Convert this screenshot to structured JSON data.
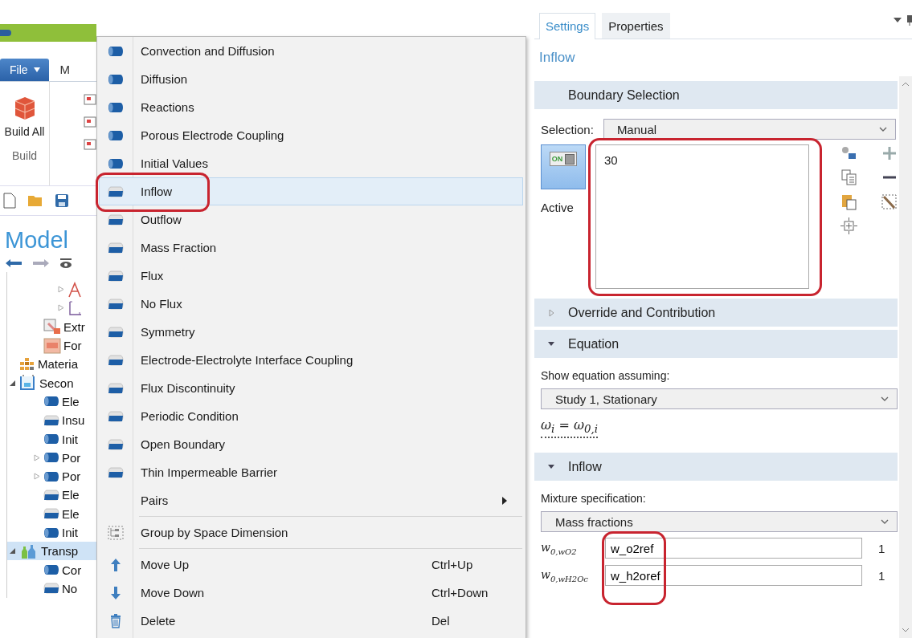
{
  "left": {
    "file_menu": "File",
    "next_tab": "M",
    "build_button": "Build All",
    "build_group": "Build",
    "browser_title": "Model",
    "tree": [
      {
        "children": [
          {
            "children": [
              {
                "kind": "sketch",
                "expanded": false,
                "selected": false
              },
              {
                "kind": "axes",
                "expanded": false,
                "selected": false
              }
            ]
          },
          {
            "kind": "operator",
            "label": "Extr",
            "selected": false
          },
          {
            "kind": "union",
            "label": "For",
            "selected": false
          }
        ]
      },
      {
        "kind": "materials",
        "label": "Materia",
        "selected": false
      },
      {
        "kind": "physics",
        "label": "Secon",
        "expanded": true,
        "selected": false,
        "children": [
          {
            "kind": "domain",
            "label": "Ele",
            "selected": false
          },
          {
            "kind": "boundary",
            "label": "Insu",
            "selected": false
          },
          {
            "kind": "domain",
            "label": "Init",
            "selected": false
          },
          {
            "kind": "domain",
            "label": "Por",
            "expanded": false,
            "selected": false
          },
          {
            "kind": "domain",
            "label": "Por",
            "expanded": false,
            "selected": false
          },
          {
            "kind": "boundary",
            "label": "Ele",
            "selected": false
          },
          {
            "kind": "boundary",
            "label": "Ele",
            "selected": false
          },
          {
            "kind": "domain",
            "label": "Init",
            "selected": false
          }
        ]
      },
      {
        "kind": "transport",
        "label": "Transp",
        "expanded": true,
        "selected": true,
        "children": [
          {
            "kind": "domain",
            "label": "Cor",
            "selected": false
          },
          {
            "kind": "boundary",
            "label": "No",
            "selected": false
          }
        ]
      }
    ]
  },
  "menu": {
    "sections": [
      {
        "items": [
          {
            "kind": "domain",
            "label": "Convection and Diffusion",
            "selected": false
          },
          {
            "kind": "domain",
            "label": "Diffusion",
            "selected": false
          },
          {
            "kind": "domain",
            "label": "Reactions",
            "selected": false
          },
          {
            "kind": "domain",
            "label": "Porous Electrode Coupling",
            "selected": false
          },
          {
            "kind": "domain",
            "label": "Initial Values",
            "selected": false
          },
          {
            "kind": "boundary",
            "label": "Inflow",
            "selected": true
          },
          {
            "kind": "boundary",
            "label": "Outflow",
            "selected": false
          },
          {
            "kind": "boundary",
            "label": "Mass Fraction",
            "selected": false
          },
          {
            "kind": "boundary",
            "label": "Flux",
            "selected": false
          },
          {
            "kind": "boundary",
            "label": "No Flux",
            "selected": false
          },
          {
            "kind": "boundary",
            "label": "Symmetry",
            "selected": false
          },
          {
            "kind": "boundary",
            "label": "Electrode-Electrolyte Interface Coupling",
            "selected": false
          },
          {
            "kind": "boundary",
            "label": "Flux Discontinuity",
            "selected": false
          },
          {
            "kind": "boundary",
            "label": "Periodic Condition",
            "selected": false
          },
          {
            "kind": "boundary",
            "label": "Open Boundary",
            "selected": false
          },
          {
            "kind": "boundary",
            "label": "Thin Impermeable Barrier",
            "selected": false
          },
          {
            "kind": "submenu",
            "label": "Pairs",
            "selected": false
          }
        ]
      },
      {
        "items": [
          {
            "kind": "group",
            "label": "Group by Space Dimension",
            "selected": false
          }
        ]
      },
      {
        "items": [
          {
            "kind": "up",
            "label": "Move Up",
            "shortcut": "Ctrl+Up",
            "selected": false
          },
          {
            "kind": "down",
            "label": "Move Down",
            "shortcut": "Ctrl+Down",
            "selected": false
          },
          {
            "kind": "delete",
            "label": "Delete",
            "shortcut": "Del",
            "selected": false
          }
        ]
      }
    ]
  },
  "settings": {
    "tabs": [
      {
        "label": "Settings",
        "selected": true
      },
      {
        "label": "Properties",
        "selected": false
      }
    ],
    "title": "Inflow",
    "boundary_selection": {
      "title": "Boundary Selection",
      "selection_label": "Selection:",
      "selection": "Manual",
      "active": {
        "text": "ON",
        "on": true,
        "label": "Active"
      },
      "entities": [
        "30"
      ]
    },
    "override": {
      "title": "Override and Contribution",
      "expanded": false
    },
    "equation": {
      "title": "Equation",
      "expanded": true,
      "label": "Show equation assuming:",
      "study": "Study 1, Stationary",
      "formula": "ω$_{i}$ = ω$_{0,i}$"
    },
    "inflow": {
      "title": "Inflow",
      "expanded": true,
      "label": "Mixture specification:",
      "mixture": "Mass fractions",
      "fractions": [
        {
          "symbol": "w$_{0,wO2}$",
          "value": "w_o2ref",
          "unit": "1"
        },
        {
          "symbol": "w$_{0,wH2Oc}$",
          "value": "w_h2oref",
          "unit": "1"
        }
      ]
    }
  }
}
